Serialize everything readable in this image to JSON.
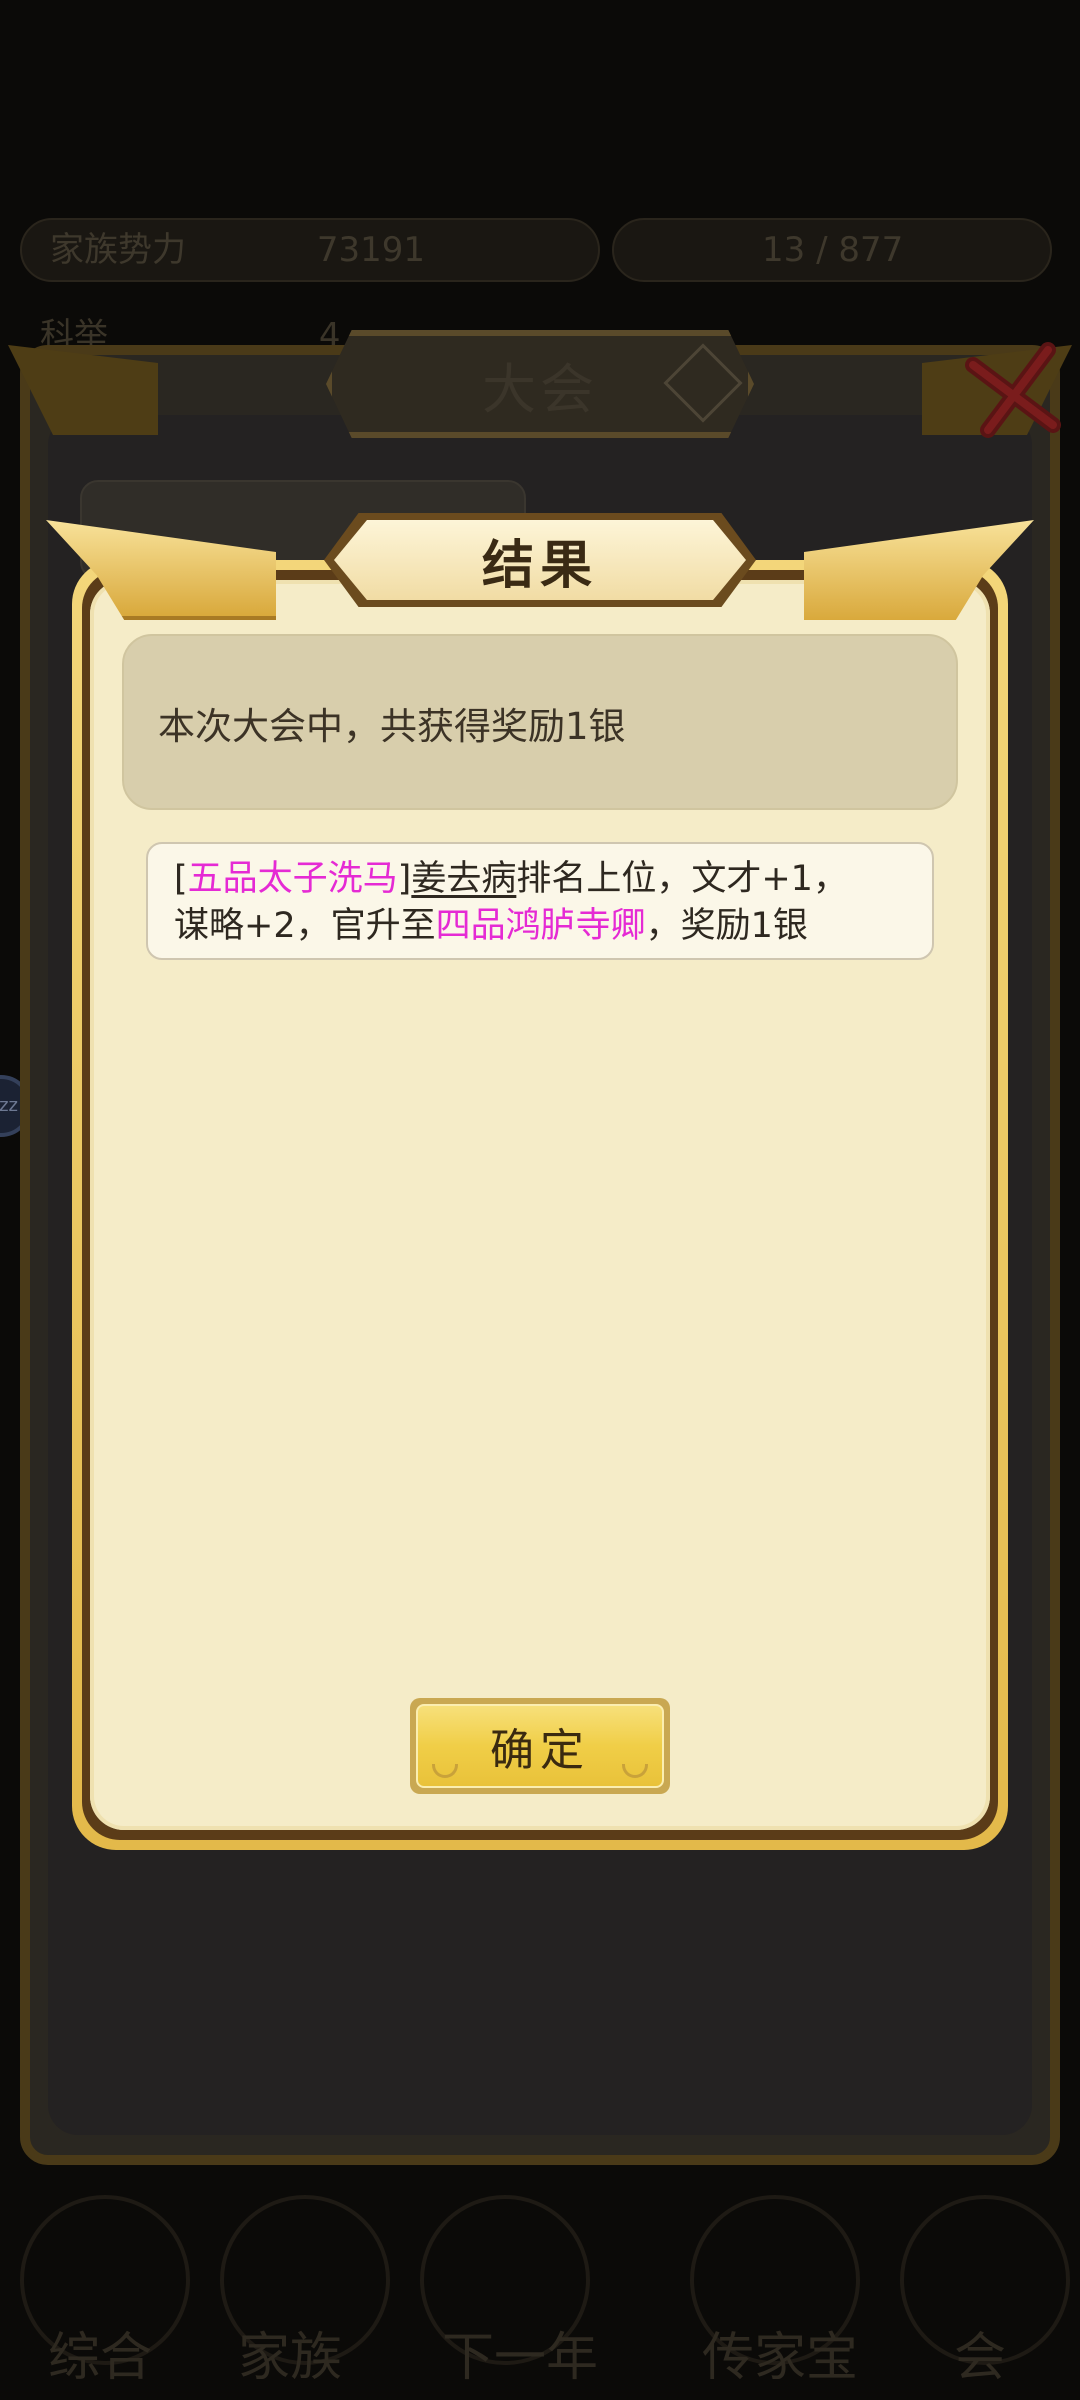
{
  "background": {
    "stats": [
      {
        "label": "家族势力",
        "value": "73191"
      },
      {
        "label": "",
        "value": "13 / 877"
      }
    ],
    "stat_row2": {
      "label": "科举",
      "value": "4"
    },
    "nav_labels": [
      "综合",
      "家族",
      "下一年",
      "传家宝",
      "会"
    ],
    "side_bubble_text": "zz"
  },
  "outer_window": {
    "title": "大会",
    "help_icon": "question-icon",
    "close_icon": "close-icon"
  },
  "dialog": {
    "title": "结果",
    "summary": "本次大会中，共获得奖励1银",
    "event": {
      "bracket_open": "[",
      "rank": "五品太子洗马",
      "bracket_close": "]",
      "name": "姜去病",
      "text1": "排名上位，文才+1，",
      "text2": "谋略+2，官升至",
      "new_rank": "四品鸿胪寺卿",
      "text3": "，奖励1银"
    },
    "confirm_label": "确定"
  },
  "colors": {
    "highlight": "#e52ad4",
    "parchment": "#f5ecc8",
    "gold": "#e9c23a"
  }
}
